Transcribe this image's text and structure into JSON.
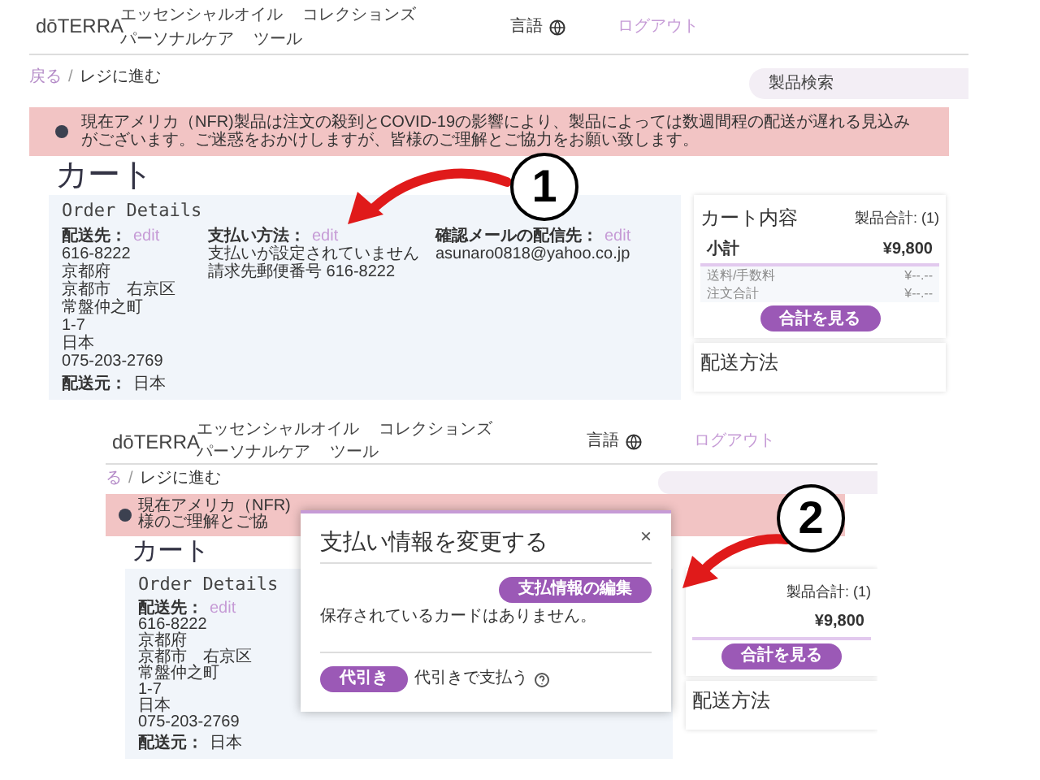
{
  "screens": [
    {
      "nav": {
        "logo": "dōTERRA",
        "links": [
          "エッセンシャルオイル",
          "コレクションズ",
          "パーソナルケア",
          "ツール"
        ],
        "language": "言語",
        "logout": "ログアウト"
      },
      "breadcrumb": {
        "back": "戻る",
        "separator": "/",
        "current": "レジに進む"
      },
      "search": {
        "placeholder": "製品検索"
      },
      "notice": {
        "lines": [
          "現在アメリカ（NFR)製品は注文の殺到とCOVID-19の影響により、製品によっては数週間程の配送が遅れる見込みがございます。ご迷惑をおかけしますが、皆様のご理解とご協力をお願い致します。"
        ]
      },
      "title": "カート",
      "order_details": {
        "heading": "Order Details",
        "columns": [
          {
            "label": "配送先：",
            "edit": "edit",
            "lines": [
              "616-8222",
              "京都府",
              "京都市　右京区",
              "常盤仲之町",
              "1-7",
              "日本",
              "075-203-2769"
            ]
          },
          {
            "label": "支払い方法：",
            "edit": "edit",
            "lines": [
              "支払いが設定されていません",
              "請求先郵便番号 616-8222"
            ]
          },
          {
            "label": "確認メールの配信先：",
            "edit": "edit",
            "lines": [
              "asunaro0818@yahoo.co.jp"
            ]
          }
        ],
        "ship_from": {
          "label": "配送元：",
          "value": "日本"
        }
      },
      "cart": {
        "heading": "カート内容",
        "count": "製品合計: (1)",
        "rows": [
          {
            "label": "小計",
            "value": "¥9,800",
            "kind": "strong"
          },
          {
            "label": "送料/手数料",
            "value": "¥--.--",
            "kind": "faint"
          },
          {
            "label": "注文合計",
            "value": "¥--.--",
            "kind": "faint"
          }
        ],
        "button": "合計を見る"
      },
      "shipping": {
        "heading": "配送方法"
      }
    },
    {
      "nav": {
        "logo": "dōTERRA",
        "links": [
          "エッセンシャルオイル",
          "コレクションズ",
          "パーソナルケア",
          "ツール"
        ],
        "language": "言語",
        "logout": "ログアウト"
      },
      "breadcrumb": {
        "back": "る",
        "separator": "/",
        "current": "レジに進む"
      },
      "notice": {
        "lines": [
          "現在アメリカ（NFR)",
          "様のご理解とご協"
        ]
      },
      "title": "カート",
      "order_details": {
        "heading": "Order Details",
        "columns": [
          {
            "label": "配送先：",
            "edit": "edit",
            "lines": [
              "616-8222",
              "京都府",
              "京都市　右京区",
              "常盤仲之町",
              "1-7",
              "日本",
              "075-203-2769"
            ]
          }
        ],
        "ship_from": {
          "label": "配送元：",
          "value": "日本"
        }
      },
      "cart": {
        "count": "製品合計: (1)",
        "rows": [
          {
            "value": "¥9,800",
            "kind": "strong"
          }
        ],
        "button": "合計を見る"
      },
      "shipping": {
        "heading": "配送方法"
      },
      "modal": {
        "title": "支払い情報を変更する",
        "close": "×",
        "edit_button": "支払情報の編集",
        "message": "保存されているカードはありません。",
        "cod_button": "代引き",
        "cod_label": "代引きで支払う"
      }
    }
  ],
  "annotations": [
    {
      "number": "1"
    },
    {
      "number": "2"
    }
  ]
}
